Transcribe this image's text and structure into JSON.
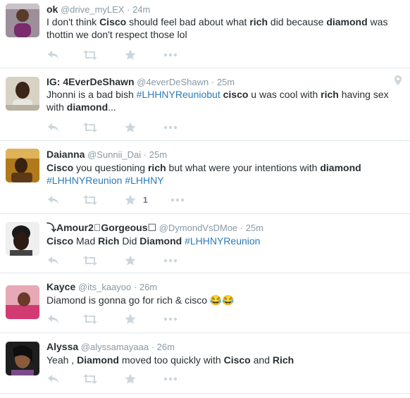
{
  "colors": {
    "name": "#292f33",
    "meta": "#8899a6",
    "hashtag": "#2b7bb9",
    "action_icon": "#ccd6dd",
    "divider": "#e1e8ed"
  },
  "icons": {
    "reply": "reply-icon",
    "retweet": "retweet-icon",
    "favorite": "star-icon",
    "more": "more-dots-icon",
    "location": "location-pin-icon"
  },
  "tweets": [
    {
      "name": "ok",
      "handle": "@drive_myLEX",
      "time": "24m",
      "text": {
        "p1": "I don't think ",
        "b1": "Cisco",
        "p2": " should feel bad about what ",
        "b2": "rich",
        "p3": " did because ",
        "b3": "diamond",
        "p4": " was thottin we don't respect those lol"
      }
    },
    {
      "name": "IG: 4EverDeShawn",
      "handle": "@4everDeShawn",
      "time": "25m",
      "text": {
        "p1": "Jhonni is a bad bish ",
        "h1": "#LHHNYReuniobut",
        "p2": " ",
        "b1": "cisco",
        "p3": " u was cool with ",
        "b2": "rich",
        "p4": " having sex with ",
        "b3": "diamond",
        "p5": "..."
      }
    },
    {
      "name": "Daianna",
      "handle": "@Sunnii_Dai",
      "time": "25m",
      "text": {
        "b1": "Cisco",
        "p1": " you questioning ",
        "b2": "rich",
        "p2": " but what were your intentions with ",
        "b3": "diamond",
        "h1": "#LHHNYReunion",
        "h2": "#LHHNY"
      },
      "favorites": "1"
    },
    {
      "name": "⤵Amour2⃣Gorgeous☐",
      "handle": "@DymondVsDMoe",
      "time": "25m",
      "text": {
        "b1": "Cisco",
        "p1": " Mad ",
        "b2": "Rich",
        "p2": " Did ",
        "b3": "Diamond",
        "h1": "#LHHNYReunion"
      }
    },
    {
      "name": "Kayce",
      "handle": "@its_kaayoo",
      "time": "26m",
      "text": {
        "p1": "Diamond is gonna go for rich & cisco 😂😂"
      }
    },
    {
      "name": "Alyssa",
      "handle": "@alyssamayaaa",
      "time": "26m",
      "text": {
        "p1": "Yeah , ",
        "b1": "Diamond",
        "p2": " moved too quickly with ",
        "b2": "Cisco",
        "p3": " and ",
        "b3": "Rich"
      }
    }
  ]
}
